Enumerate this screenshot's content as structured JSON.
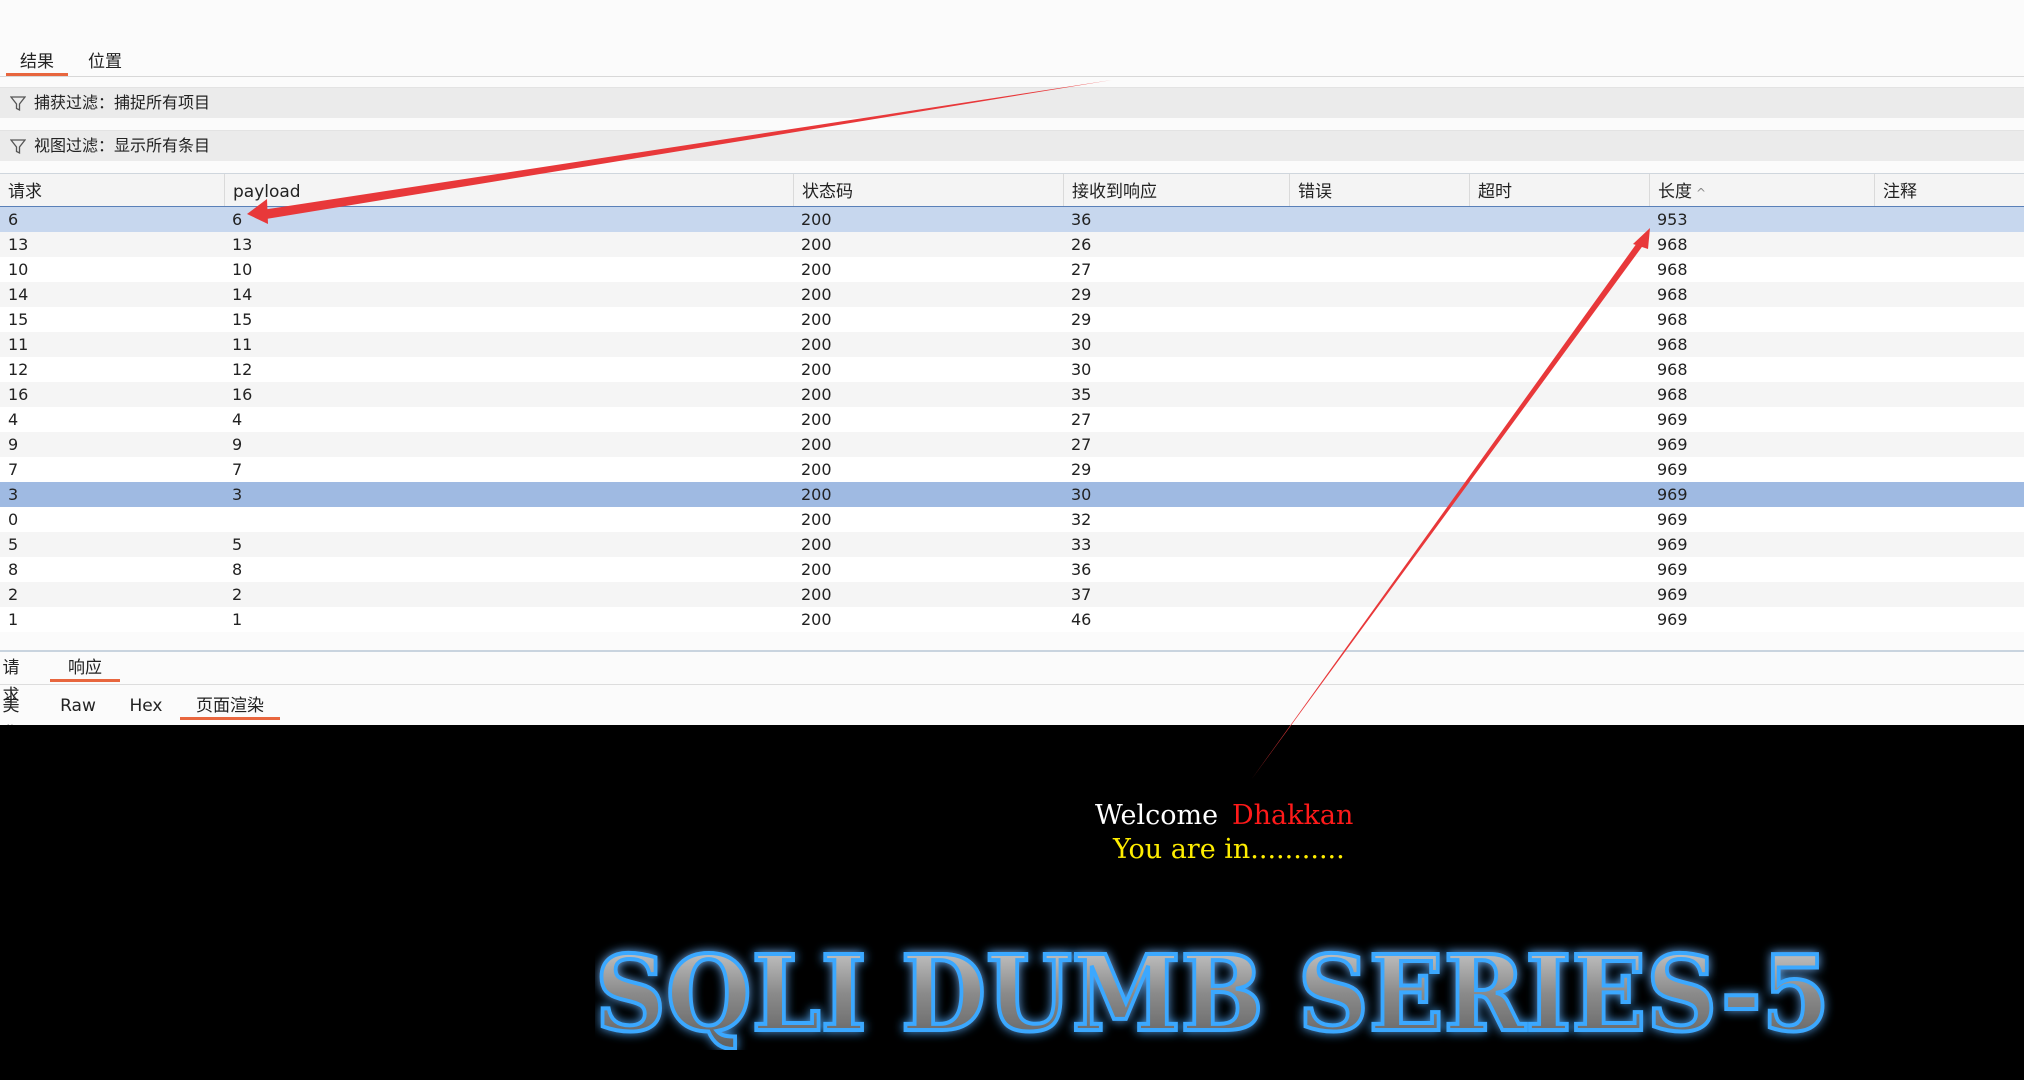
{
  "tabs": [
    {
      "label": "结果",
      "active": true
    },
    {
      "label": "位置",
      "active": false
    }
  ],
  "capture_filter": {
    "label": "捕获过滤：捕捉所有项目"
  },
  "view_filter": {
    "label": "视图过滤：显示所有条目"
  },
  "table": {
    "columns": [
      "请求",
      "payload",
      "状态码",
      "接收到响应",
      "错误",
      "超时",
      "长度",
      "注释"
    ],
    "sort_indicator": "^",
    "rows": [
      {
        "request": "6",
        "payload": "6",
        "status": "200",
        "received": "36",
        "error": "",
        "timeout": "",
        "length": "953",
        "comment": ""
      },
      {
        "request": "13",
        "payload": "13",
        "status": "200",
        "received": "26",
        "error": "",
        "timeout": "",
        "length": "968",
        "comment": ""
      },
      {
        "request": "10",
        "payload": "10",
        "status": "200",
        "received": "27",
        "error": "",
        "timeout": "",
        "length": "968",
        "comment": ""
      },
      {
        "request": "14",
        "payload": "14",
        "status": "200",
        "received": "29",
        "error": "",
        "timeout": "",
        "length": "968",
        "comment": ""
      },
      {
        "request": "15",
        "payload": "15",
        "status": "200",
        "received": "29",
        "error": "",
        "timeout": "",
        "length": "968",
        "comment": ""
      },
      {
        "request": "11",
        "payload": "11",
        "status": "200",
        "received": "30",
        "error": "",
        "timeout": "",
        "length": "968",
        "comment": ""
      },
      {
        "request": "12",
        "payload": "12",
        "status": "200",
        "received": "30",
        "error": "",
        "timeout": "",
        "length": "968",
        "comment": ""
      },
      {
        "request": "16",
        "payload": "16",
        "status": "200",
        "received": "35",
        "error": "",
        "timeout": "",
        "length": "968",
        "comment": ""
      },
      {
        "request": "4",
        "payload": "4",
        "status": "200",
        "received": "27",
        "error": "",
        "timeout": "",
        "length": "969",
        "comment": ""
      },
      {
        "request": "9",
        "payload": "9",
        "status": "200",
        "received": "27",
        "error": "",
        "timeout": "",
        "length": "969",
        "comment": ""
      },
      {
        "request": "7",
        "payload": "7",
        "status": "200",
        "received": "29",
        "error": "",
        "timeout": "",
        "length": "969",
        "comment": ""
      },
      {
        "request": "3",
        "payload": "3",
        "status": "200",
        "received": "30",
        "error": "",
        "timeout": "",
        "length": "969",
        "comment": ""
      },
      {
        "request": "0",
        "payload": "",
        "status": "200",
        "received": "32",
        "error": "",
        "timeout": "",
        "length": "969",
        "comment": ""
      },
      {
        "request": "5",
        "payload": "5",
        "status": "200",
        "received": "33",
        "error": "",
        "timeout": "",
        "length": "969",
        "comment": ""
      },
      {
        "request": "8",
        "payload": "8",
        "status": "200",
        "received": "36",
        "error": "",
        "timeout": "",
        "length": "969",
        "comment": ""
      },
      {
        "request": "2",
        "payload": "2",
        "status": "200",
        "received": "37",
        "error": "",
        "timeout": "",
        "length": "969",
        "comment": ""
      },
      {
        "request": "1",
        "payload": "1",
        "status": "200",
        "received": "46",
        "error": "",
        "timeout": "",
        "length": "969",
        "comment": ""
      }
    ]
  },
  "response_tabs": [
    {
      "label": "请求",
      "active": false
    },
    {
      "label": "响应",
      "active": true
    }
  ],
  "view_tabs": [
    {
      "label": "美化",
      "active": false
    },
    {
      "label": "Raw",
      "active": false
    },
    {
      "label": "Hex",
      "active": false
    },
    {
      "label": "页面渲染",
      "active": true
    }
  ],
  "render": {
    "welcome": "Welcome",
    "name": "Dhakkan",
    "status": "You are in...........",
    "logo_text": "SQLI DUMB SERIES-5"
  },
  "colors": {
    "accent_underline": "#e8663e",
    "selected_row": "#c7d7ee",
    "selected_row_strong": "#9fbae2",
    "annotation_arrow": "#e8383a",
    "render_bg": "#000000",
    "welcome": "#ffffff",
    "name": "#ff1a1a",
    "status": "#ffee00"
  },
  "icons": {
    "filter": "funnel-icon",
    "sort": "sort-ascending-icon"
  }
}
